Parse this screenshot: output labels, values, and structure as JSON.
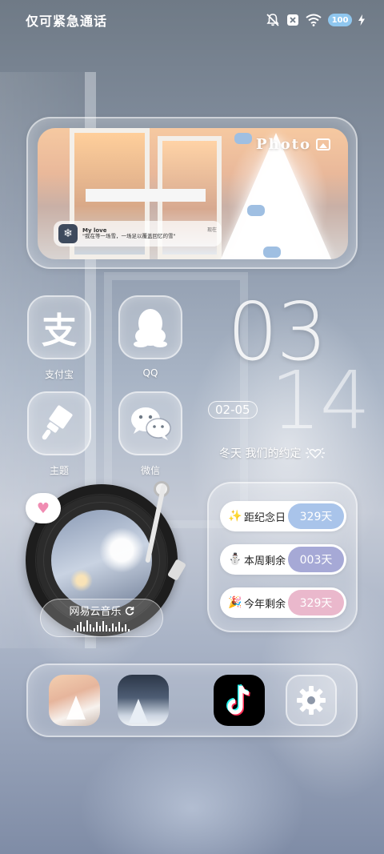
{
  "status_bar": {
    "carrier_text": "仅可紧急通话",
    "battery": "100"
  },
  "photo_widget": {
    "title": "Photo",
    "notification": {
      "app": "My love",
      "body": "\"我在等一场雪，一场足以覆盖回忆的雪\"",
      "time": "现在"
    }
  },
  "apps": [
    {
      "label": "支付宝",
      "glyph": "支"
    },
    {
      "label": "QQ"
    },
    {
      "label": "主题"
    },
    {
      "label": "微信"
    }
  ],
  "clock": {
    "hour": "03",
    "minute": "14",
    "date": "02-05",
    "caption": "冬天 我们的约定"
  },
  "music": {
    "name": "网易云音乐"
  },
  "countdown": [
    {
      "emoji": "✨",
      "label": "距纪念日",
      "days": "329天",
      "color": "#a9c4ea"
    },
    {
      "emoji": "⛄",
      "label": "本周剩余",
      "days": "003天",
      "color": "#a6a9d6"
    },
    {
      "emoji": "🎉",
      "label": "今年剩余",
      "days": "329天",
      "color": "#eab8cc"
    }
  ],
  "dock": {
    "icons": [
      "photo-thumbnail-1",
      "photo-thumbnail-2",
      "tiktok-icon",
      "settings-icon"
    ]
  }
}
